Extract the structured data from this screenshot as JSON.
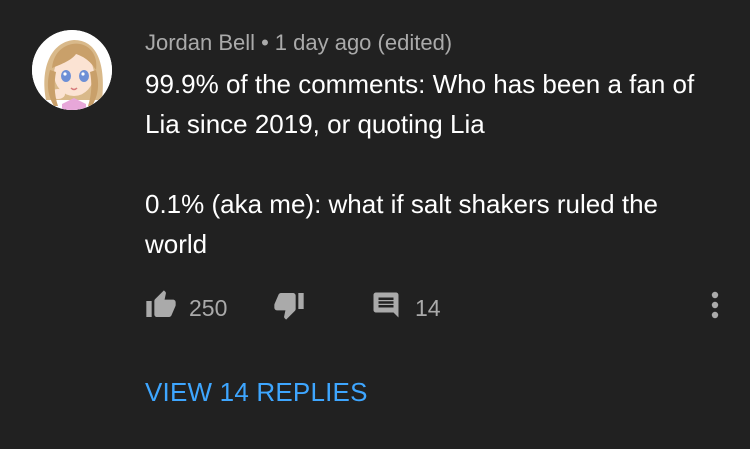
{
  "comment": {
    "author": "Jordan Bell",
    "separator": "•",
    "timestamp": "1 day ago (edited)",
    "paragraphs": [
      "99.9% of the comments: Who has been a fan of Lia since 2019, or quoting Lia",
      "0.1% (aka me): what if salt shakers ruled the world"
    ],
    "like_count": "250",
    "reply_count": "14",
    "view_replies_label": "VIEW 14 REPLIES",
    "icons": {
      "like": "thumbs-up-icon",
      "dislike": "thumbs-down-icon",
      "reply": "comment-icon",
      "more": "more-vertical-icon"
    },
    "colors": {
      "background": "#212121",
      "text": "#ffffff",
      "secondary_text": "#aaaaaa",
      "link": "#3ea6ff"
    }
  }
}
